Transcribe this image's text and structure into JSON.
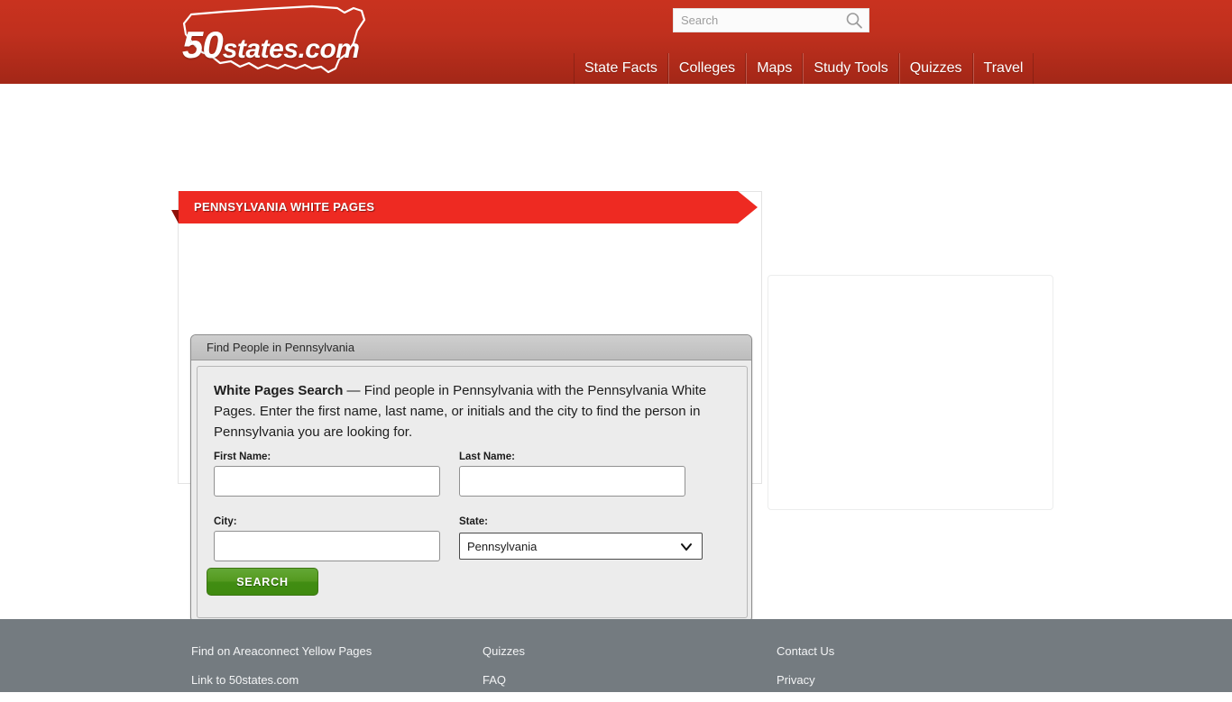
{
  "header": {
    "logo": {
      "prefix": "50",
      "suffix": "states.com",
      "icon": "us-map-outline-icon"
    },
    "search": {
      "placeholder": "Search",
      "value": "",
      "icon": "search-icon"
    },
    "nav": [
      {
        "label": "State Facts"
      },
      {
        "label": "Colleges"
      },
      {
        "label": "Maps"
      },
      {
        "label": "Study Tools"
      },
      {
        "label": "Quizzes"
      },
      {
        "label": "Travel"
      }
    ]
  },
  "content": {
    "ribbon_title": "PENNSYLVANIA WHITE PAGES",
    "panel_header": "Find People in Pennsylvania",
    "intro_bold": "White Pages Search",
    "intro_text": " — Find people in Pennsylvania with the Pennsylvania White Pages. Enter the first name, last name, or initials and the city to find the person in Pennsylvania you are looking for.",
    "fields": {
      "first_name": {
        "label": "First Name:",
        "value": "",
        "placeholder": ""
      },
      "last_name": {
        "label": "Last Name:",
        "value": "",
        "placeholder": ""
      },
      "city": {
        "label": "City:",
        "value": "",
        "placeholder": ""
      },
      "state": {
        "label": "State:",
        "value": "Pennsylvania",
        "chevron": "chevron-down-icon"
      }
    },
    "submit_label": "SEARCH"
  },
  "footer": {
    "columns": [
      {
        "links": [
          "Find on Areaconnect Yellow Pages",
          "Link to 50states.com"
        ]
      },
      {
        "links": [
          "Quizzes",
          "FAQ"
        ]
      },
      {
        "links": [
          "Contact Us",
          "Privacy"
        ]
      }
    ]
  },
  "colors": {
    "brand_red": "#c0301e",
    "ribbon_red": "#ee2a22",
    "ribbon_fold": "#8f1009",
    "footer_gray": "#747b80",
    "button_green": "#4e9420"
  }
}
